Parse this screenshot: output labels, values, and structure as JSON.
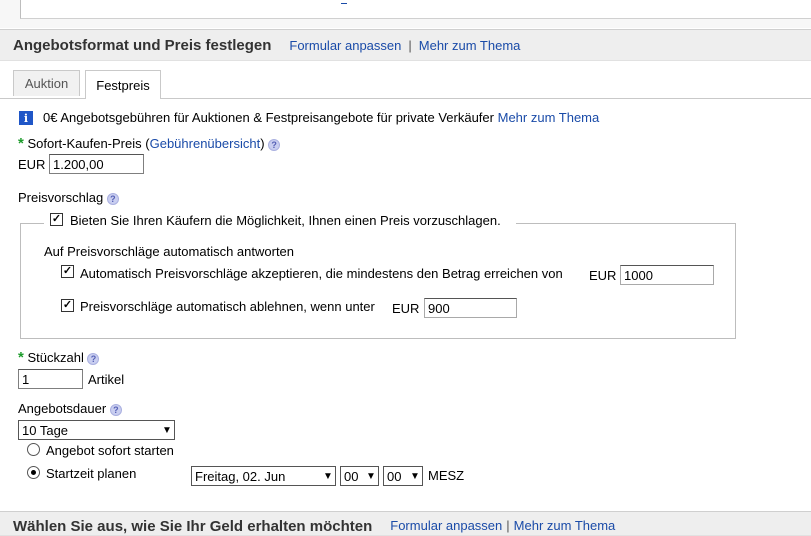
{
  "section1": {
    "title": "Angebotsformat und Preis festlegen",
    "link_customize": "Formular anpassen",
    "separator": "|",
    "link_more": "Mehr zum Thema"
  },
  "tabs": [
    {
      "label": "Auktion",
      "active": false
    },
    {
      "label": "Festpreis",
      "active": true
    }
  ],
  "info": {
    "icon": "i",
    "text": "0€ Angebotsgebühren für Auktionen & Festpreisangebote für private Verkäufer",
    "link": "Mehr zum Thema"
  },
  "buy_now": {
    "label": "Sofort-Kaufen-Preis",
    "paren_open": "(",
    "fee_link": "Gebührenübersicht",
    "paren_close": ")",
    "currency": "EUR",
    "value": "1.200,00"
  },
  "offer": {
    "label": "Preisvorschlag",
    "enable_label": "Bieten Sie Ihren Käufern die Möglichkeit, Ihnen einen Preis vorzuschlagen.",
    "auto_heading": "Auf Preisvorschläge automatisch antworten",
    "accept_label": "Automatisch Preisvorschläge akzeptieren, die mindestens den Betrag erreichen von",
    "accept_currency": "EUR",
    "accept_value": "1000",
    "decline_label": "Preisvorschläge automatisch ablehnen, wenn unter",
    "decline_currency": "EUR",
    "decline_value": "900"
  },
  "quantity": {
    "label": "Stückzahl",
    "value": "1",
    "unit": "Artikel"
  },
  "duration": {
    "label": "Angebotsdauer",
    "selected": "10 Tage",
    "start_now_label": "Angebot sofort starten",
    "schedule_label": "Startzeit planen",
    "date_selected": "Freitag, 02. Jun",
    "hour_selected": "00",
    "minute_selected": "00",
    "timezone": "MESZ"
  },
  "section2": {
    "title": "Wählen Sie aus, wie Sie Ihr Geld erhalten möchten",
    "link_customize": "Formular anpassen",
    "separator": "|",
    "link_more": "Mehr zum Thema"
  },
  "icons": {
    "required": "*",
    "help": "?",
    "check": "✓",
    "chevron": "▼"
  },
  "colors": {
    "link": "#1a4ba8",
    "required": "#1c9b2a",
    "info_icon": "#1f56c7",
    "section_bg": "#eeeeee"
  }
}
